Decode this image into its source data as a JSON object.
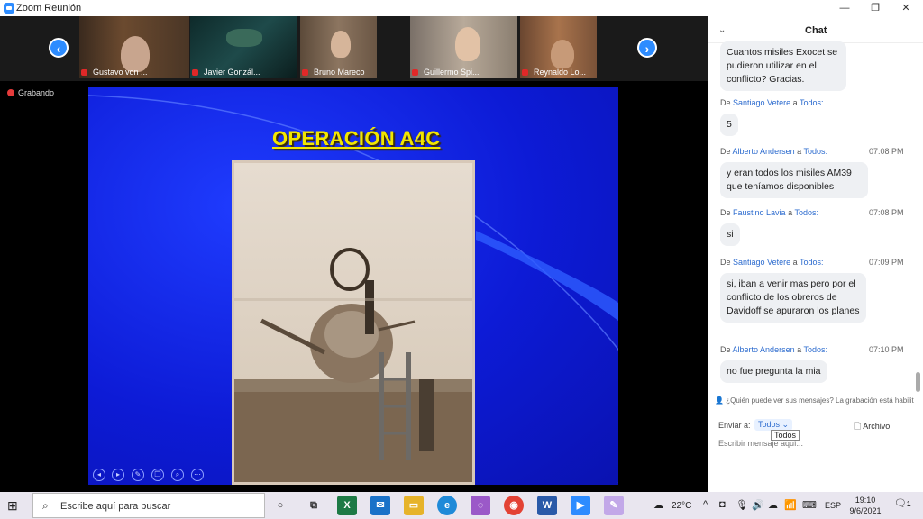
{
  "window": {
    "title": "Zoom Reunión",
    "minimize": "—",
    "maximize": "❐",
    "close": "✕"
  },
  "gallery": {
    "participants": [
      {
        "name": "Gustavo von ..."
      },
      {
        "name": "Javier Gonzál..."
      },
      {
        "name": "Bruno Mareco"
      },
      {
        "name": "Guillermo Spi..."
      },
      {
        "name": "Reynaldo Lo..."
      }
    ]
  },
  "recording": {
    "label": "Grabando"
  },
  "slide": {
    "title": "OPERACIÓN A4C"
  },
  "chat": {
    "title": "Chat",
    "messages": [
      {
        "sender": "",
        "recipient": "",
        "time": "",
        "text": "Cuantos misiles Exocet se pudieron utilizar en el conflicto? Gracias."
      },
      {
        "sender": "Santiago Vetere",
        "recipient": "Todos:",
        "time": "",
        "text": "5"
      },
      {
        "sender": "Alberto Andersen",
        "recipient": "Todos:",
        "time": "07:08 PM",
        "text": "y eran todos los misiles AM39 que teníamos disponibles"
      },
      {
        "sender": "Faustino Lavia",
        "recipient": "Todos:",
        "time": "07:08 PM",
        "text": "si"
      },
      {
        "sender": "Santiago Vetere",
        "recipient": "Todos:",
        "time": "07:09 PM",
        "text": "si, iban a venir mas pero por el conflicto de los obreros de Davidoff se apuraron los planes"
      },
      {
        "sender": "Alberto Andersen",
        "recipient": "Todos:",
        "time": "07:10 PM",
        "text": "no fue pregunta la mia"
      }
    ],
    "from_prefix": "De",
    "to_word": "a",
    "notice": "¿Quién puede ver sus mensajes? La grabación está habilit",
    "send_to_label": "Enviar a:",
    "send_to_value": "Todos",
    "send_to_tooltip": "Todos",
    "file_button": "Archivo",
    "input_placeholder": "Escribir mensaje aquí..."
  },
  "taskbar": {
    "search_placeholder": "Escribe aquí para buscar",
    "temperature": "22°C",
    "language": "ESP",
    "time": "19:10",
    "date": "9/6/2021",
    "notification_count": "1"
  }
}
